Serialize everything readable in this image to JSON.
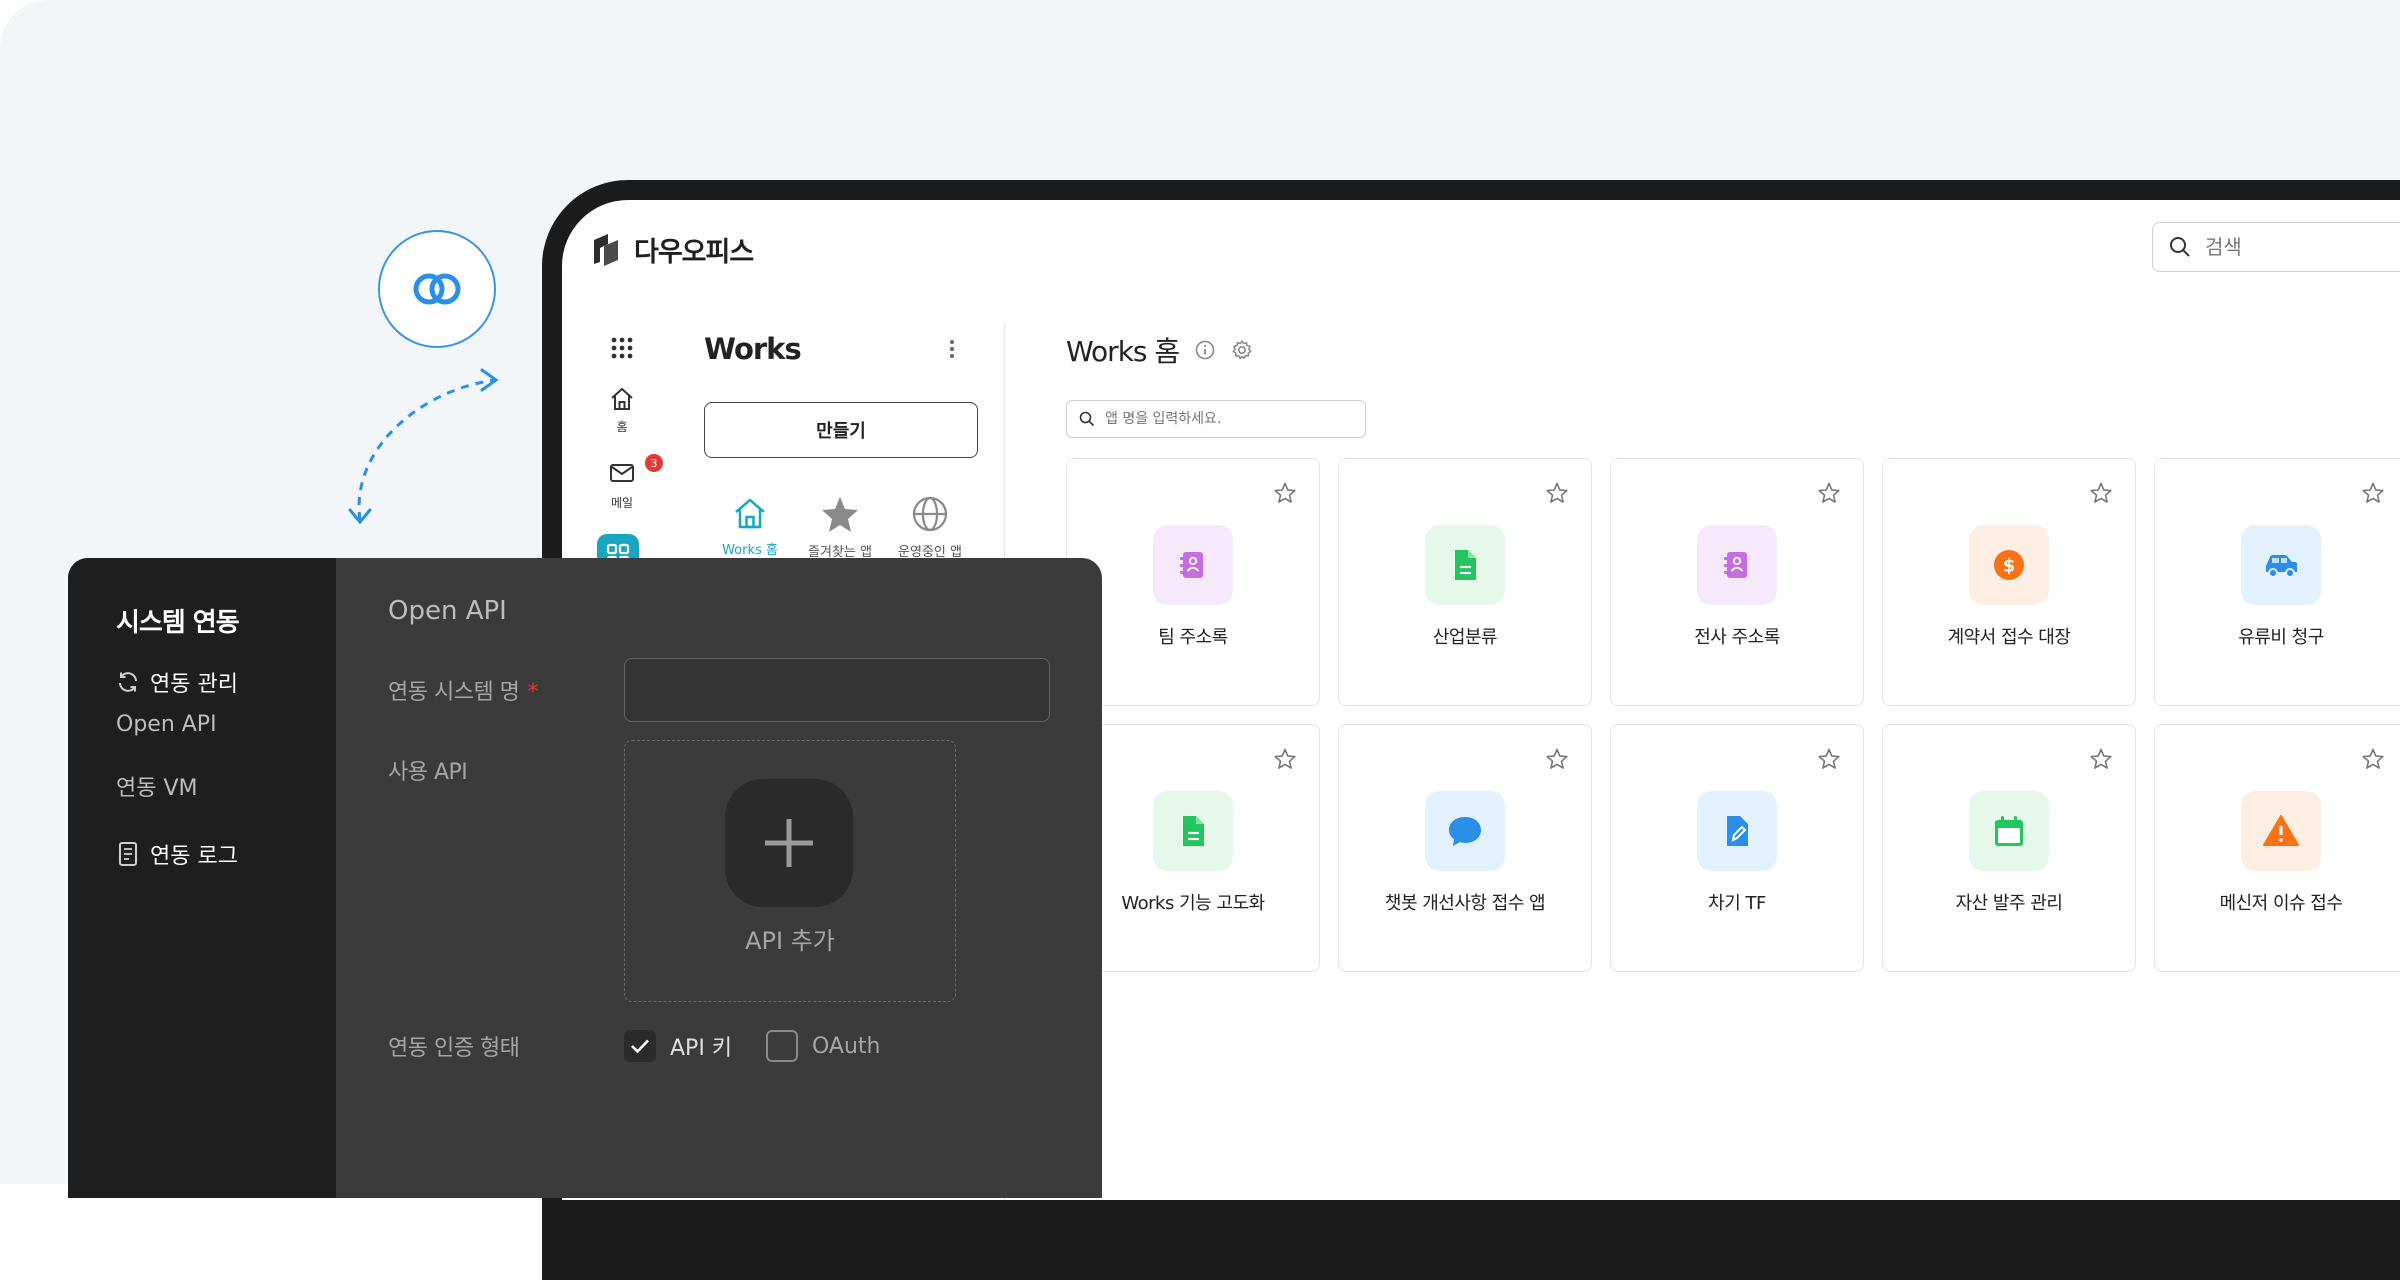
{
  "brand": {
    "name": "다우오피스"
  },
  "top_search": {
    "placeholder": "검색"
  },
  "rail": {
    "home_label": "홈",
    "mail_label": "메일",
    "mail_badge": "3"
  },
  "works": {
    "title": "Works",
    "create_label": "만들기",
    "tabs": [
      {
        "label": "Works 홈",
        "active": true
      },
      {
        "label": "즐겨찾는 앱",
        "active": false
      },
      {
        "label": "운영중인 앱",
        "active": false
      }
    ]
  },
  "home": {
    "title": "Works 홈",
    "search_placeholder": "앱 명을 입력하세요."
  },
  "apps": [
    {
      "name": "팀 주소록",
      "icon": "address-book-icon",
      "bg": "#f6e9fb",
      "fg": "#c46ee0"
    },
    {
      "name": "산업분류",
      "icon": "document-icon",
      "bg": "#e5f8ea",
      "fg": "#22c55e"
    },
    {
      "name": "전사 주소록",
      "icon": "address-book-icon",
      "bg": "#f6e9fb",
      "fg": "#c46ee0"
    },
    {
      "name": "계약서 접수 대장",
      "icon": "dollar-icon",
      "bg": "#fdeee4",
      "fg": "#f97316"
    },
    {
      "name": "유류비 청구",
      "icon": "car-icon",
      "bg": "#e3f1fc",
      "fg": "#2b8fe8"
    },
    {
      "name": "Works 기능 고도화",
      "icon": "document-icon",
      "bg": "#e5f8ea",
      "fg": "#22c55e"
    },
    {
      "name": "챗봇 개선사항 접수 앱",
      "icon": "chat-icon",
      "bg": "#e3f1fc",
      "fg": "#2b8fe8"
    },
    {
      "name": "차기 TF",
      "icon": "edit-document-icon",
      "bg": "#e3f1fc",
      "fg": "#2b8fe8"
    },
    {
      "name": "자산 발주 관리",
      "icon": "calendar-icon",
      "bg": "#e5f8ea",
      "fg": "#22c55e"
    },
    {
      "name": "메신저 이슈 접수",
      "icon": "warning-icon",
      "bg": "#fdeee4",
      "fg": "#f97316"
    }
  ],
  "panel": {
    "side_title": "시스템 연동",
    "menu_manage": "연동 관리",
    "menu_open_api": "Open API",
    "menu_vm": "연동 VM",
    "menu_log": "연동 로그",
    "form_title": "Open API",
    "label_system_name": "연동 시스템 명",
    "required_mark": "*",
    "label_use_api": "사용 API",
    "api_add_label": "API 추가",
    "label_auth": "연동 인증 형태",
    "auth_options": [
      {
        "label": "API 키",
        "checked": true
      },
      {
        "label": "OAuth",
        "checked": false
      }
    ]
  },
  "colors": {
    "accent": "#1aa5c1",
    "link_blue": "#3b94e5",
    "required": "#e53935"
  }
}
